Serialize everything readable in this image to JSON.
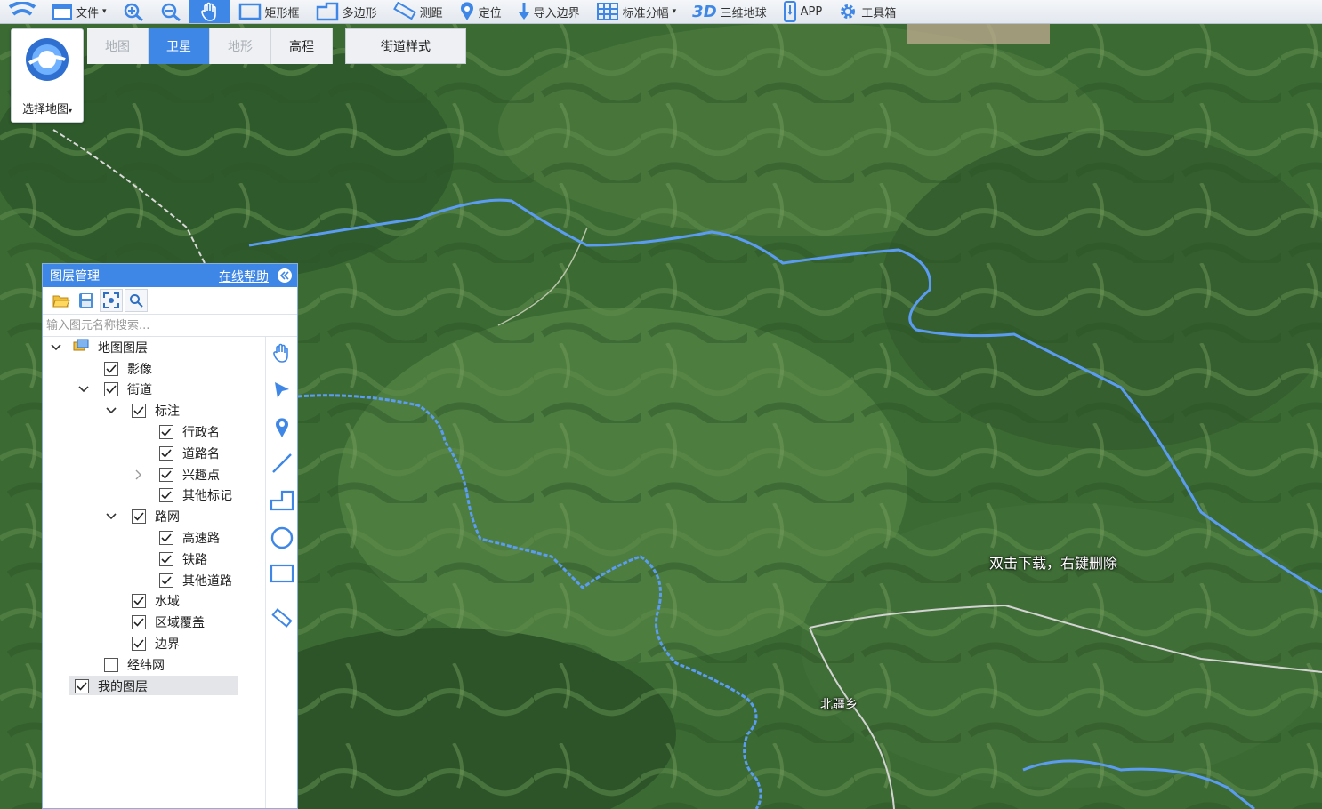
{
  "toolbar": {
    "items": [
      {
        "label": "文件",
        "icon": "file-icon",
        "dropdown": true
      },
      {
        "label": "",
        "icon": "zoom-in-icon"
      },
      {
        "label": "",
        "icon": "zoom-out-icon"
      },
      {
        "label": "",
        "icon": "hand-pan-icon",
        "active": true
      },
      {
        "label": "矩形框",
        "icon": "rectangle-select-icon"
      },
      {
        "label": "多边形",
        "icon": "polygon-select-icon"
      },
      {
        "label": "测距",
        "icon": "ruler-icon"
      },
      {
        "label": "定位",
        "icon": "location-pin-icon"
      },
      {
        "label": "导入边界",
        "icon": "import-boundary-icon"
      },
      {
        "label": "标准分幅",
        "icon": "grid-icon",
        "dropdown": true
      },
      {
        "label": "三维地球",
        "prefix": "3D"
      },
      {
        "label": "APP",
        "icon": "phone-icon"
      },
      {
        "label": "工具箱",
        "icon": "gear-icon"
      }
    ]
  },
  "map_chooser": {
    "label": "选择地图"
  },
  "map_types": [
    {
      "label": "地图",
      "state": "disabled"
    },
    {
      "label": "卫星",
      "state": "active"
    },
    {
      "label": "地形",
      "state": "disabled"
    },
    {
      "label": "高程",
      "state": "enabled"
    }
  ],
  "street_style_label": "街道样式",
  "layer_panel": {
    "title": "图层管理",
    "help_link": "在线帮助",
    "search_placeholder": "输入图元名称搜索...",
    "tree": [
      {
        "label": "地图图层",
        "level": 0,
        "expanded": true,
        "checkbox": false,
        "folder_icon": true
      },
      {
        "label": "影像",
        "level": 1,
        "checked": true
      },
      {
        "label": "街道",
        "level": 1,
        "checked": true,
        "expanded": true
      },
      {
        "label": "标注",
        "level": 2,
        "checked": true,
        "expanded": true
      },
      {
        "label": "行政名",
        "level": 3,
        "checked": true
      },
      {
        "label": "道路名",
        "level": 3,
        "checked": true
      },
      {
        "label": "兴趣点",
        "level": 3,
        "checked": true,
        "collapsed": true
      },
      {
        "label": "其他标记",
        "level": 3,
        "checked": true
      },
      {
        "label": "路网",
        "level": 2,
        "checked": true,
        "expanded": true
      },
      {
        "label": "高速路",
        "level": 3,
        "checked": true
      },
      {
        "label": "铁路",
        "level": 3,
        "checked": true
      },
      {
        "label": "其他道路",
        "level": 3,
        "checked": true
      },
      {
        "label": "水域",
        "level": 2,
        "checked": true
      },
      {
        "label": "区域覆盖",
        "level": 2,
        "checked": true
      },
      {
        "label": "边界",
        "level": 2,
        "checked": true
      },
      {
        "label": "经纬网",
        "level": 1,
        "checked": false
      },
      {
        "label": "我的图层",
        "level": 0,
        "checked": true,
        "selected": true
      }
    ]
  },
  "map": {
    "hint": "双击下载，右键删除",
    "town_label": "北疆乡"
  },
  "colors": {
    "accent": "#3f87e6",
    "boundary": "#5b9cf2",
    "road": "#d9d9d9"
  }
}
